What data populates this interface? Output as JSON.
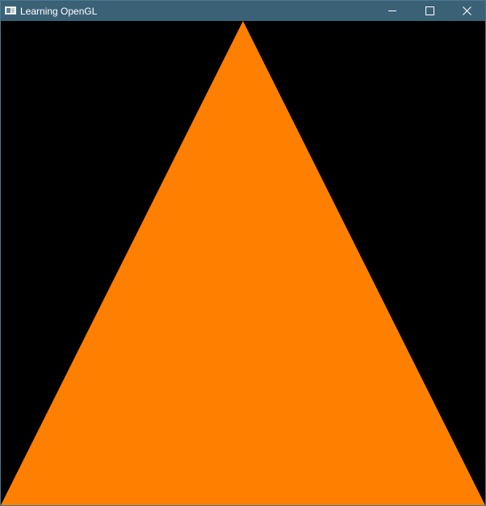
{
  "window": {
    "title": "Learning OpenGL",
    "controls": {
      "minimize_icon": "minimize-icon",
      "maximize_icon": "maximize-icon",
      "close_icon": "close-icon"
    }
  },
  "scene": {
    "background_color": "#000000",
    "shape": "triangle",
    "fill_color": "#ff7f00"
  },
  "colors": {
    "titlebar": "#3b6176"
  }
}
